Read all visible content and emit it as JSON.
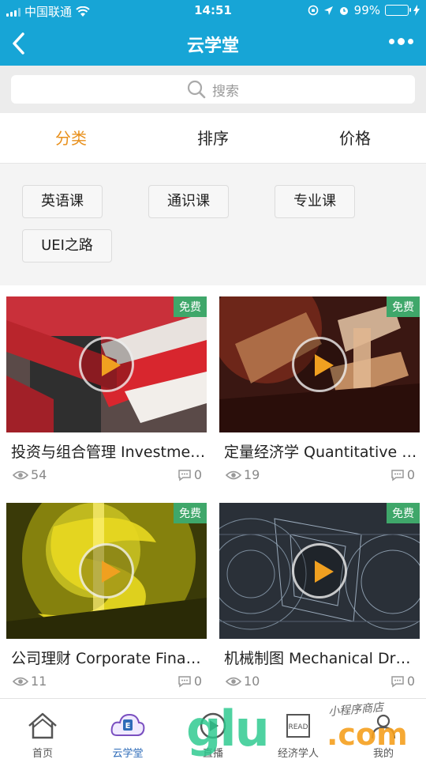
{
  "status_bar": {
    "carrier": "中国联通",
    "time": "14:51",
    "battery": "99%"
  },
  "nav": {
    "title": "云学堂"
  },
  "search": {
    "placeholder": "搜索"
  },
  "tabs": [
    {
      "label": "分类",
      "active": true
    },
    {
      "label": "排序",
      "active": false
    },
    {
      "label": "价格",
      "active": false
    }
  ],
  "filters": [
    "英语课",
    "通识课",
    "专业课",
    "UEI之路"
  ],
  "courses": [
    {
      "title": "投资与组合管理 Investment and Portfolio Management",
      "badge": "免费",
      "views": "54",
      "comments": "0"
    },
    {
      "title": "定量经济学 Quantitative Economics",
      "badge": "免费",
      "views": "19",
      "comments": "0"
    },
    {
      "title": "公司理财 Corporate Finance",
      "badge": "免费",
      "views": "11",
      "comments": "0"
    },
    {
      "title": "机械制图 Mechanical Drawing",
      "badge": "免费",
      "views": "10",
      "comments": "0"
    }
  ],
  "tabbar": [
    {
      "label": "首页",
      "icon": "home-icon"
    },
    {
      "label": "云学堂",
      "icon": "e-learning-icon",
      "active": true
    },
    {
      "label": "直播",
      "icon": "live-icon"
    },
    {
      "label": "经济学人",
      "icon": "read-icon"
    },
    {
      "label": "我的",
      "icon": "user-icon"
    }
  ],
  "watermark": {
    "brand": "glu",
    "domain": ".com",
    "text": "小程序商店"
  },
  "colors": {
    "header": "#17a5d6",
    "accent": "#e8901c",
    "badge": "#3fa76a",
    "tab_active": "#2d6bb8"
  }
}
